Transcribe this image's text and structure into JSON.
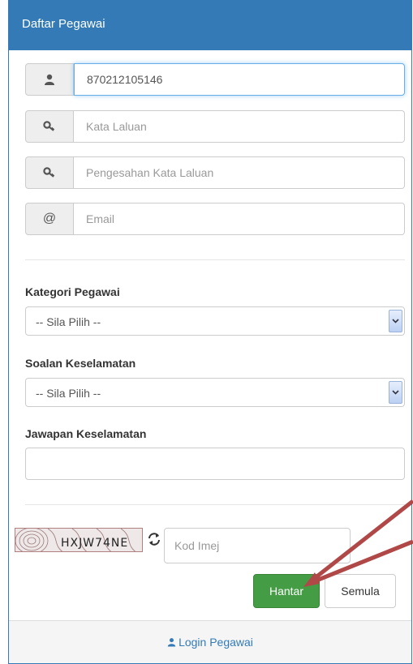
{
  "panel": {
    "title": "Daftar Pegawai"
  },
  "form": {
    "username": {
      "value": "870212105146",
      "icon": "user-icon"
    },
    "password": {
      "placeholder": "Kata Laluan",
      "icon": "key-icon"
    },
    "confirm_password": {
      "placeholder": "Pengesahan Kata Laluan",
      "icon": "key-icon"
    },
    "email": {
      "placeholder": "Email",
      "icon": "at-icon"
    },
    "kategori": {
      "label": "Kategori Pegawai",
      "selected": "-- Sila Pilih --"
    },
    "soalan": {
      "label": "Soalan Keselamatan",
      "selected": "-- Sila Pilih --"
    },
    "jawapan": {
      "label": "Jawapan Keselamatan",
      "value": ""
    },
    "captcha": {
      "text": "HXJW74NE",
      "placeholder": "Kod Imej"
    }
  },
  "buttons": {
    "submit": "Hantar",
    "reset": "Semula"
  },
  "footer": {
    "link": "Login Pegawai"
  },
  "colors": {
    "primary": "#337ab7",
    "success": "#449d44",
    "annotation_arrow": "#b04848"
  }
}
